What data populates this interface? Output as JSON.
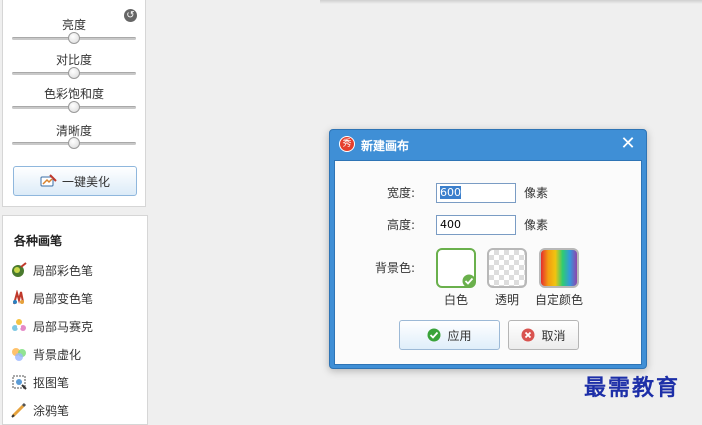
{
  "adjust": {
    "sliders": [
      {
        "label": "亮度",
        "value": 0.5
      },
      {
        "label": "对比度",
        "value": 0.5
      },
      {
        "label": "色彩饱和度",
        "value": 0.5
      },
      {
        "label": "清晰度",
        "value": 0.5
      }
    ],
    "one_click_label": "一键美化"
  },
  "brushes": {
    "title": "各种画笔",
    "items": [
      {
        "label": "局部彩色笔",
        "icon": "color-brush-icon"
      },
      {
        "label": "局部变色笔",
        "icon": "recolor-brush-icon"
      },
      {
        "label": "局部马赛克",
        "icon": "mosaic-icon"
      },
      {
        "label": "背景虚化",
        "icon": "blur-icon"
      },
      {
        "label": "抠图笔",
        "icon": "cutout-icon"
      },
      {
        "label": "涂鸦笔",
        "icon": "doodle-pen-icon"
      }
    ]
  },
  "dialog": {
    "title": "新建画布",
    "app_icon_text": "秀",
    "width_label": "宽度:",
    "width_value": "600",
    "height_label": "高度:",
    "height_value": "400",
    "unit": "像素",
    "bg_label": "背景色:",
    "swatches": [
      {
        "label": "白色",
        "selected": true
      },
      {
        "label": "透明",
        "selected": false
      },
      {
        "label": "自定颜色",
        "selected": false
      }
    ],
    "apply_label": "应用",
    "cancel_label": "取消"
  },
  "watermark": "最需教育",
  "colors": {
    "dialog_title_bar": "#3f8fd6",
    "selected_swatch_border": "#6ab04c",
    "watermark": "#1d2fa8"
  }
}
